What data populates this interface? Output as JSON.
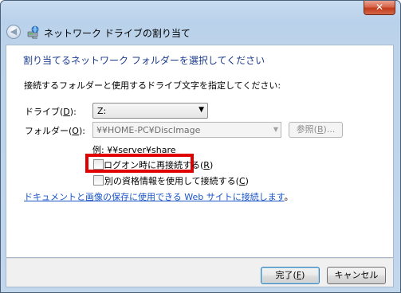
{
  "window": {
    "title": "ネットワーク ドライブの割り当て",
    "close_label": "✕"
  },
  "main": {
    "heading": "割り当てるネットワーク フォルダーを選択してください",
    "instruction": "接続するフォルダーと使用するドライブ文字を指定してください:",
    "drive": {
      "label": "ドライブ(",
      "accesskey": "D",
      "label_suffix": "):",
      "value": "Z:"
    },
    "folder": {
      "label": "フォルダー(",
      "accesskey": "O",
      "label_suffix": "):",
      "value": "¥¥HOME-PC¥DiscImage"
    },
    "browse_button": {
      "label": "参照(",
      "accesskey": "B",
      "label_suffix": ")..."
    },
    "example": "例: ¥¥server¥share",
    "reconnect_checkbox": {
      "label": "ログオン時に再接続する(",
      "accesskey": "R",
      "label_suffix": ")",
      "checked": false
    },
    "credentials_checkbox": {
      "label": "別の資格情報を使用して接続する(",
      "accesskey": "C",
      "label_suffix": ")",
      "checked": false
    },
    "link_text": "ドキュメントと画像の保存に使用できる Web サイトに接続します",
    "link_period": "。"
  },
  "footer": {
    "finish_button": {
      "label": "完了(",
      "accesskey": "F",
      "label_suffix": ")"
    },
    "cancel_button": {
      "label": "キャンセル"
    }
  },
  "colors": {
    "heading": "#1a3a8c",
    "link": "#1a55c8",
    "highlight": "#e00000"
  }
}
